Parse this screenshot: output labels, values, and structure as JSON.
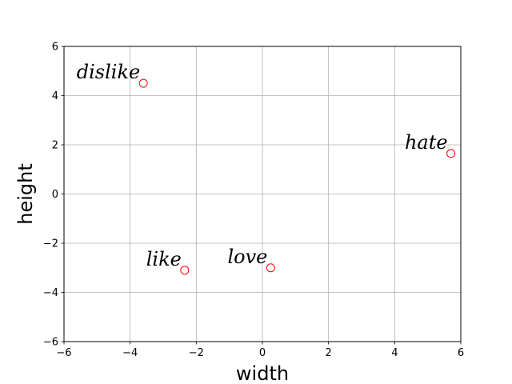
{
  "chart_data": {
    "type": "scatter",
    "title": "",
    "xlabel": "width",
    "ylabel": "height",
    "xlim": [
      -6,
      6
    ],
    "ylim": [
      -6,
      6
    ],
    "xticks": [
      -6,
      -4,
      -2,
      0,
      2,
      4,
      6
    ],
    "yticks": [
      -6,
      -4,
      -2,
      0,
      2,
      4,
      6
    ],
    "grid": true,
    "marker_color": "#ff0000",
    "points": [
      {
        "label": "dislike",
        "x": -3.6,
        "y": 4.5
      },
      {
        "label": "hate",
        "x": 5.7,
        "y": 1.65
      },
      {
        "label": "like",
        "x": -2.35,
        "y": -3.1
      },
      {
        "label": "love",
        "x": 0.25,
        "y": -3.0
      }
    ]
  }
}
